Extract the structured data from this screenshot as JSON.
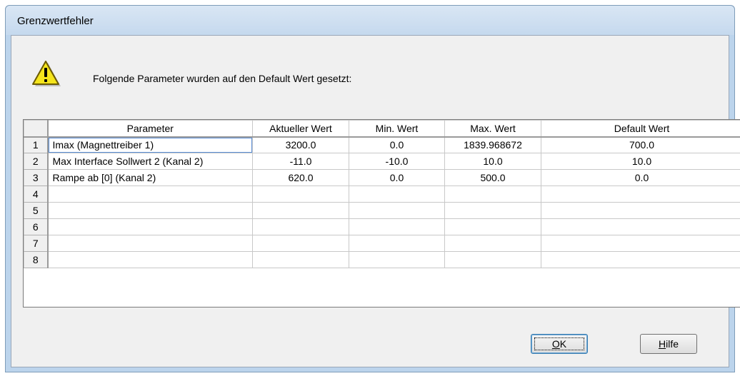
{
  "window": {
    "title": "Grenzwertfehler"
  },
  "message": "Folgende Parameter wurden auf den Default Wert gesetzt:",
  "icon": {
    "name": "warning-icon",
    "color": "#f5e51c"
  },
  "table": {
    "columns": [
      "Parameter",
      "Aktueller Wert",
      "Min. Wert",
      "Max. Wert",
      "Default Wert"
    ],
    "rows": [
      {
        "num": "1",
        "cells": [
          "Imax (Magnettreiber 1)",
          "3200.0",
          "0.0",
          "1839.968672",
          "700.0"
        ]
      },
      {
        "num": "2",
        "cells": [
          "Max Interface Sollwert 2 (Kanal 2)",
          "-11.0",
          "-10.0",
          "10.0",
          "10.0"
        ]
      },
      {
        "num": "3",
        "cells": [
          "Rampe ab [0] (Kanal 2)",
          "620.0",
          "0.0",
          "500.0",
          "0.0"
        ]
      },
      {
        "num": "4",
        "cells": [
          "",
          "",
          "",
          "",
          ""
        ]
      },
      {
        "num": "5",
        "cells": [
          "",
          "",
          "",
          "",
          ""
        ]
      },
      {
        "num": "6",
        "cells": [
          "",
          "",
          "",
          "",
          ""
        ]
      },
      {
        "num": "7",
        "cells": [
          "",
          "",
          "",
          "",
          ""
        ]
      },
      {
        "num": "8",
        "cells": [
          "",
          "",
          "",
          "",
          ""
        ]
      }
    ]
  },
  "buttons": {
    "ok": "OK",
    "help": "Hilfe"
  }
}
